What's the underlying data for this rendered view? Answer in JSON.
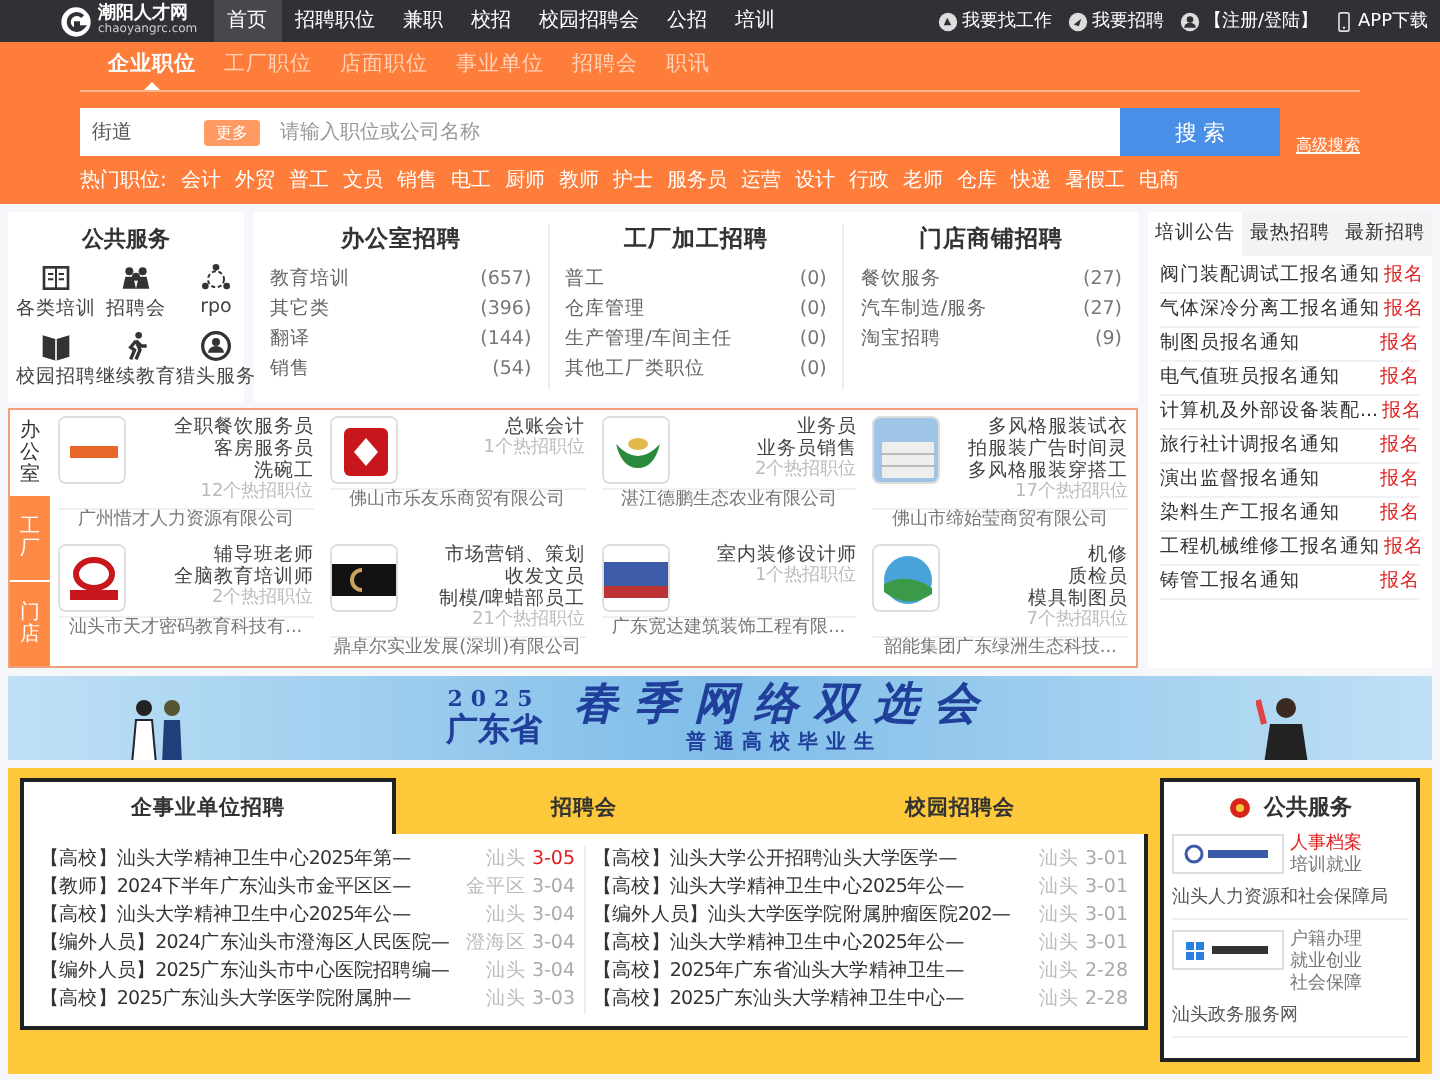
{
  "topbar": {
    "logo": {
      "name": "潮阳人才网",
      "domain": "chaoyangrc.com"
    },
    "nav": [
      {
        "label": "首页",
        "selected": true
      },
      {
        "label": "招聘职位",
        "selected": false
      },
      {
        "label": "兼职",
        "selected": false
      },
      {
        "label": "校招",
        "selected": false
      },
      {
        "label": "校园招聘会",
        "selected": false
      },
      {
        "label": "公招",
        "selected": false
      },
      {
        "label": "培训",
        "selected": false
      }
    ],
    "actions": [
      {
        "kind": "find",
        "label": "我要找工作"
      },
      {
        "kind": "hire",
        "label": "我要招聘"
      },
      {
        "kind": "user",
        "label": "【注册/登陆】"
      },
      {
        "kind": "app",
        "label": "APP下载"
      }
    ]
  },
  "search": {
    "tabs": [
      {
        "label": "企业职位",
        "selected": true
      },
      {
        "label": "工厂职位",
        "selected": false
      },
      {
        "label": "店面职位",
        "selected": false
      },
      {
        "label": "事业单位",
        "selected": false
      },
      {
        "label": "招聘会",
        "selected": false
      },
      {
        "label": "职讯",
        "selected": false
      }
    ],
    "location": "街道",
    "tag": "更多",
    "placeholder": "请输入职位或公司名称",
    "button": "搜 索",
    "advanced": "高级搜索",
    "hot_label": "热门职位:",
    "hot": [
      "会计",
      "外贸",
      "普工",
      "文员",
      "销售",
      "电工",
      "厨师",
      "教师",
      "护士",
      "服务员",
      "运营",
      "设计",
      "行政",
      "老师",
      "仓库",
      "快递",
      "暑假工",
      "电商"
    ]
  },
  "public_services": {
    "title": "公共服务",
    "items": [
      {
        "kind": "training",
        "label": "各类培训"
      },
      {
        "kind": "fair",
        "label": "招聘会"
      },
      {
        "kind": "rpo",
        "label": "rpo"
      },
      {
        "kind": "campus",
        "label": "校园招聘"
      },
      {
        "kind": "education",
        "label": "继续教育"
      },
      {
        "kind": "headhunt",
        "label": "猎头服务"
      }
    ]
  },
  "categories": [
    {
      "title": "办公室招聘",
      "items": [
        {
          "name": "教育培训",
          "count": "(657)"
        },
        {
          "name": "其它类",
          "count": "(396)"
        },
        {
          "name": "翻译",
          "count": "(144)"
        },
        {
          "name": "销售",
          "count": "(54)"
        }
      ]
    },
    {
      "title": "工厂加工招聘",
      "items": [
        {
          "name": "普工",
          "count": "(0)"
        },
        {
          "name": "仓库管理",
          "count": "(0)"
        },
        {
          "name": "生产管理/车间主任",
          "count": "(0)"
        },
        {
          "name": "其他工厂类职位",
          "count": "(0)"
        }
      ]
    },
    {
      "title": "门店商铺招聘",
      "items": [
        {
          "name": "餐饮服务",
          "count": "(27)"
        },
        {
          "name": "汽车制造/服务",
          "count": "(27)"
        },
        {
          "name": "淘宝招聘",
          "count": "(9)"
        }
      ]
    }
  ],
  "notices": {
    "tabs": [
      {
        "label": "培训公告",
        "selected": true
      },
      {
        "label": "最热招聘",
        "selected": false
      },
      {
        "label": "最新招聘",
        "selected": false
      }
    ],
    "items": [
      {
        "title": "阀门装配调试工报名通知",
        "action": "报名"
      },
      {
        "title": "气体深冷分离工报名通知",
        "action": "报名"
      },
      {
        "title": "制图员报名通知",
        "action": "报名"
      },
      {
        "title": "电气值班员报名通知",
        "action": "报名"
      },
      {
        "title": "计算机及外部设备装配...",
        "action": "报名"
      },
      {
        "title": "旅行社计调报名通知",
        "action": "报名"
      },
      {
        "title": "演出监督报名通知",
        "action": "报名"
      },
      {
        "title": "染料生产工报名通知",
        "action": "报名"
      },
      {
        "title": "工程机械维修工报名通知",
        "action": "报名"
      },
      {
        "title": "铸管工报名通知",
        "action": "报名"
      }
    ]
  },
  "companies": {
    "tabs": [
      {
        "label": "办公室",
        "selected": true
      },
      {
        "label": "工厂",
        "selected": false
      },
      {
        "label": "门店",
        "selected": false
      }
    ],
    "items": [
      {
        "kind": "text",
        "jobs": [
          "全职餐饮服务员",
          "客房服务员",
          "洗碗工"
        ],
        "count": "12个热招职位",
        "name": "广州惜才人力资源有限公司"
      },
      {
        "kind": "red",
        "jobs": [
          "总账会计"
        ],
        "count": "1个热招职位",
        "name": "佛山市乐友乐商贸有限公司"
      },
      {
        "kind": "leaf",
        "jobs": [
          "业务员",
          "业务员销售"
        ],
        "count": "2个热招职位",
        "name": "湛江德鹏生态农业有限公司"
      },
      {
        "kind": "building",
        "jobs": [
          "多风格服装试衣",
          "拍服装广告时间灵",
          "多风格服装穿搭工"
        ],
        "count": "17个热招职位",
        "name": "佛山市缔始莹商贸有限公司"
      },
      {
        "kind": "ring",
        "jobs": [
          "辅导班老师",
          "全脑教育培训师"
        ],
        "count": "2个热招职位",
        "name": "汕头市天才密码教育科技有..."
      },
      {
        "kind": "dark",
        "jobs": [
          "市场营销、策划",
          "收发文员",
          "制模/啤蜡部员工"
        ],
        "count": "21个热招职位",
        "name": "鼎卓尔实业发展(深圳)有限公司"
      },
      {
        "kind": "stage",
        "jobs": [
          "室内装修设计师"
        ],
        "count": "1个热招职位",
        "name": "广东宽达建筑装饰工程有限..."
      },
      {
        "kind": "circle",
        "jobs": [
          "机修",
          "质检员",
          "模具制图员"
        ],
        "count": "7个热招职位",
        "name": "韶能集团广东绿洲生态科技..."
      }
    ]
  },
  "banner": {
    "year": "2025",
    "region": "广东省",
    "title": "春季网络双选会",
    "subtitle": "普通高校毕业生"
  },
  "bottom": {
    "tabs": [
      {
        "label": "企事业单位招聘",
        "selected": true
      },
      {
        "label": "招聘会",
        "selected": false
      },
      {
        "label": "校园招聘会",
        "selected": false
      }
    ],
    "columns": [
      [
        {
          "title": "【高校】汕头大学精神卫生中心2025年第—",
          "place": "汕头",
          "date": "3-05",
          "highlight": true
        },
        {
          "title": "【教师】2024下半年广东汕头市金平区区—",
          "place": "金平区",
          "date": "3-04",
          "highlight": false
        },
        {
          "title": "【高校】汕头大学精神卫生中心2025年公—",
          "place": "汕头",
          "date": "3-04",
          "highlight": false
        },
        {
          "title": "【编外人员】2024广东汕头市澄海区人民医院—",
          "place": "澄海区",
          "date": "3-04",
          "highlight": false
        },
        {
          "title": "【编外人员】2025广东汕头市中心医院招聘编—",
          "place": "汕头",
          "date": "3-04",
          "highlight": false
        },
        {
          "title": "【高校】2025广东汕头大学医学院附属肿—",
          "place": "汕头",
          "date": "3-03",
          "highlight": false
        }
      ],
      [
        {
          "title": "【高校】汕头大学公开招聘汕头大学医学—",
          "place": "汕头",
          "date": "3-01",
          "highlight": false
        },
        {
          "title": "【高校】汕头大学精神卫生中心2025年公—",
          "place": "汕头",
          "date": "3-01",
          "highlight": false
        },
        {
          "title": "【编外人员】汕头大学医学院附属肿瘤医院202—",
          "place": "汕头",
          "date": "3-01",
          "highlight": false
        },
        {
          "title": "【高校】汕头大学精神卫生中心2025年公—",
          "place": "汕头",
          "date": "3-01",
          "highlight": false
        },
        {
          "title": "【高校】2025年广东省汕头大学精神卫生—",
          "place": "汕头",
          "date": "2-28",
          "highlight": false
        },
        {
          "title": "【高校】2025广东汕头大学精神卫生中心—",
          "place": "汕头",
          "date": "2-28",
          "highlight": false
        }
      ]
    ]
  },
  "gov_services": {
    "title": "公共服务",
    "entries": [
      {
        "kind": "hr",
        "links": [
          {
            "label": "人事档案",
            "hot": true
          },
          {
            "label": "培训就业",
            "hot": false
          }
        ],
        "name": "汕头人力资源和社会保障局"
      },
      {
        "kind": "gov",
        "links": [
          {
            "label": "户籍办理",
            "hot": false
          },
          {
            "label": "就业创业",
            "hot": false
          },
          {
            "label": "社会保障",
            "hot": false
          }
        ],
        "name": "汕头政务服务网"
      }
    ]
  }
}
